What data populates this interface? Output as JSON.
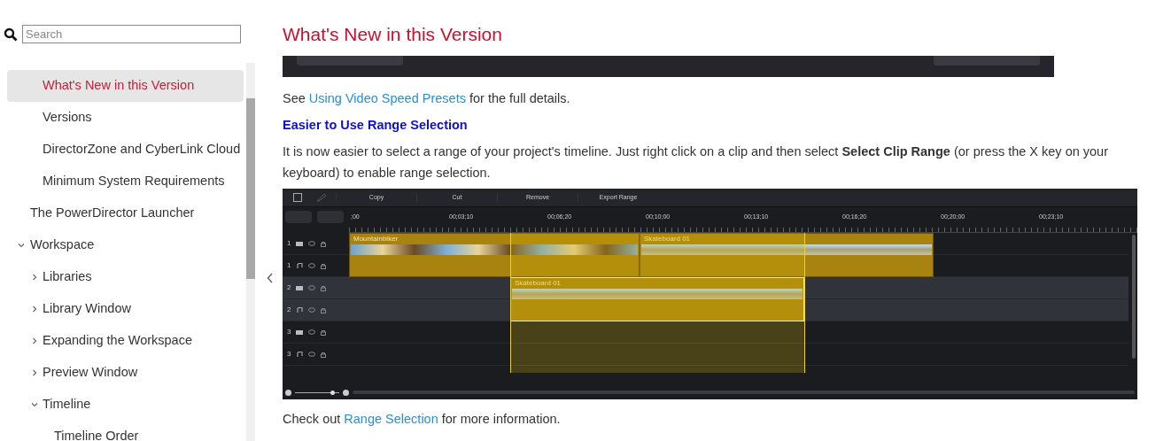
{
  "search": {
    "placeholder": "Search"
  },
  "sidebar": {
    "items": [
      {
        "children": [
          {
            "label": "What's New in this Version",
            "selected": true
          },
          {
            "label": "Versions",
            "selected": false
          },
          {
            "label": "DirectorZone and CyberLink Cloud",
            "selected": false
          },
          {
            "label": "Minimum System Requirements",
            "selected": false
          }
        ]
      },
      {
        "label": "The PowerDirector Launcher",
        "selected": false
      },
      {
        "label": "Workspace",
        "selected": false,
        "expanded": true,
        "children": [
          {
            "label": "Libraries",
            "selected": false,
            "expanded": false
          },
          {
            "label": "Library Window",
            "selected": false,
            "expanded": false
          },
          {
            "label": "Expanding the Workspace",
            "selected": false,
            "expanded": false
          },
          {
            "label": "Preview Window",
            "selected": false,
            "expanded": false
          },
          {
            "label": "Timeline",
            "selected": false,
            "expanded": true,
            "children": [
              {
                "label": "Timeline Order",
                "selected": false
              }
            ]
          }
        ]
      }
    ]
  },
  "content": {
    "title": "What's New in this Version",
    "blocks": [
      {
        "kind": "cut_image"
      },
      {
        "kind": "paragraph",
        "parts": [
          {
            "kind": "text",
            "text": "See"
          },
          {
            "kind": "link",
            "text": "Using Video Speed Presets"
          },
          {
            "kind": "text",
            "text": "for the full details."
          }
        ]
      },
      {
        "kind": "heading",
        "text": "Easier to Use Range Selection"
      },
      {
        "kind": "rich",
        "text": "It is now easier to select a range of your project's timeline. Just right click on a clip and then select **Select Clip Range** (or press the X key on your keyboard) to enable range selection."
      },
      {
        "kind": "timeline",
        "toolbar": [
          "Copy",
          "Cut",
          "Remove",
          "Export Range"
        ],
        "ruler": [
          ";00",
          "00;03;10",
          "00;06;20",
          "00;10;00",
          "00;13;10",
          "00;16;20",
          "00;20;00",
          "00;23;10"
        ],
        "tracks": [
          {
            "number": "1",
            "kind": "video",
            "selected": false
          },
          {
            "number": "1",
            "kind": "audio",
            "selected": false
          },
          {
            "number": "2",
            "kind": "video",
            "selected": true
          },
          {
            "number": "2",
            "kind": "audio",
            "selected": true
          },
          {
            "number": "3",
            "kind": "video",
            "selected": false
          },
          {
            "number": "3",
            "kind": "audio",
            "selected": false
          }
        ],
        "zoom": {
          "level": 0.85
        },
        "clips": [
          {
            "name": "Mountainbiker",
            "selected": false
          },
          {
            "name": "Skateboard 01",
            "selected": false
          },
          {
            "name": "Skateboard 01",
            "selected": true
          }
        ]
      },
      {
        "kind": "paragraph",
        "parts": [
          {
            "kind": "text",
            "text": "Check out"
          },
          {
            "kind": "link",
            "text": "Range Selection"
          },
          {
            "kind": "text",
            "text": "for more information."
          }
        ]
      }
    ]
  }
}
